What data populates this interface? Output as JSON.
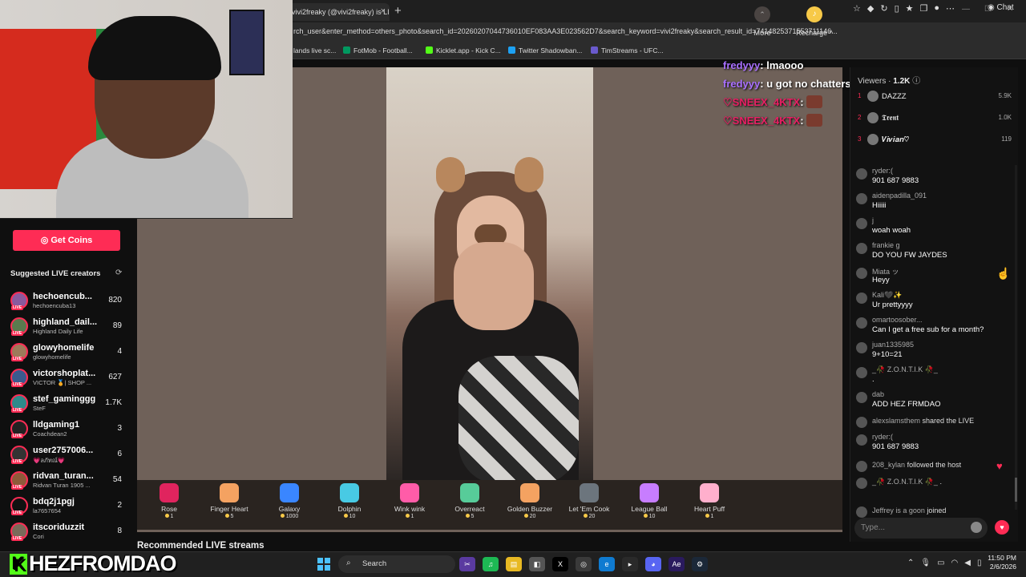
{
  "browser": {
    "tab_title": "vivi2freaky (@vivi2freaky) is LI",
    "new_tab": "+",
    "url": "rch_user&enter_method=others_photo&search_id=20260207044736010EF083AA3E023562D7&search_keyword=vivi2freaky&search_result_id=7414825371553711146...",
    "chat_label": "Chat",
    "bookmarks": [
      {
        "label": "lands live sc...",
        "color": "#333"
      },
      {
        "label": "FotMob - Football...",
        "color": "#00985f"
      },
      {
        "label": "Kicklet.app - Kick C...",
        "color": "#53fc18"
      },
      {
        "label": "Twitter Shadowban...",
        "color": "#1da1f2"
      },
      {
        "label": "TimStreams - UFC...",
        "color": "#6a5acd"
      }
    ]
  },
  "overlay_chat": [
    {
      "name": "fredyyy",
      "message": " lmaooo"
    },
    {
      "name": "fredyyy",
      "message": " u got no chatters"
    },
    {
      "name": "SNEEX_4KTX",
      "message": ""
    },
    {
      "name": "SNEEX_4KTX",
      "message": ""
    }
  ],
  "sidebar": {
    "get_coins": "Get Coins",
    "suggested_title": "Suggested LIVE creators",
    "creators": [
      {
        "name": "hechoencub...",
        "sub": "hechoencuba13",
        "count": "820"
      },
      {
        "name": "highland_dail...",
        "sub": "Highland Daily Life",
        "count": "89"
      },
      {
        "name": "glowyhomelife",
        "sub": "glowyhomelife",
        "count": "4"
      },
      {
        "name": "victorshoplat...",
        "sub": "VICTOR 🏅| SHOP ...",
        "count": "627"
      },
      {
        "name": "stef_gaminggg",
        "sub": "SteF",
        "count": "1.7K"
      },
      {
        "name": "lldgaming1",
        "sub": "Coachdean2",
        "count": "3"
      },
      {
        "name": "user2757006...",
        "sub": "💗ลภัทณ์💗",
        "count": "6"
      },
      {
        "name": "ridvan_turan...",
        "sub": "Ridvan Turan 1905 ...",
        "count": "54"
      },
      {
        "name": "bdq2j1pgj",
        "sub": "la7657654",
        "count": "2"
      },
      {
        "name": "itscoriduzzit",
        "sub": "Cori",
        "count": "8"
      }
    ]
  },
  "gifts": [
    {
      "name": "Rose",
      "price": "1",
      "color": "#e0245e"
    },
    {
      "name": "Finger Heart",
      "price": "5",
      "color": "#f4a261"
    },
    {
      "name": "Galaxy",
      "price": "1000",
      "color": "#3a86ff"
    },
    {
      "name": "Dolphin",
      "price": "10",
      "color": "#48cae4"
    },
    {
      "name": "Wink wink",
      "price": "1",
      "color": "#ff5ca8"
    },
    {
      "name": "Overreact",
      "price": "5",
      "color": "#57cc99"
    },
    {
      "name": "Golden Buzzer",
      "price": "20",
      "color": "#f4a261"
    },
    {
      "name": "Let 'Em Cook",
      "price": "20",
      "color": "#6c757d"
    },
    {
      "name": "League Ball",
      "price": "10",
      "color": "#c77dff"
    },
    {
      "name": "Heart Puff",
      "price": "1",
      "color": "#ffafcc"
    }
  ],
  "more_label": "More",
  "recharge_label": "Recharge ^",
  "recommended_title": "Recommended LIVE streams",
  "chat": {
    "viewers_label": "Viewers",
    "viewers_count": "1.2K",
    "top_viewers": [
      {
        "rank": "1",
        "name": "DAZZZ",
        "score": "5.9K"
      },
      {
        "rank": "2",
        "name": "𝕿𝖗𝖊𝖓𝖙",
        "score": "1.0K"
      },
      {
        "rank": "3",
        "name": "𝑽𝒊𝒗𝒊𝒂𝒏♡",
        "score": "119"
      }
    ],
    "messages": [
      {
        "user": "ryder:(",
        "text": "901 687 9883"
      },
      {
        "user": "aidenpadilla_091",
        "text": "Hiiiii"
      },
      {
        "user": "j",
        "text": "woah woah"
      },
      {
        "user": "frankie g",
        "text": "DO YOU FW JAYDES"
      },
      {
        "user": "Miata ッ",
        "text": "Heyy"
      },
      {
        "user": "Kali🖤✨",
        "text": "Ur prettyyyy"
      },
      {
        "user": "omartoosober...",
        "text": "Can I get a free sub for a month?"
      },
      {
        "user": "juan1335985",
        "text": "9+10=21"
      },
      {
        "user": "_🥀 Z.O.N.T.I.K 🥀_",
        "text": "."
      },
      {
        "user": "dab",
        "text": "ADD HEZ FRMDAO"
      },
      {
        "user": "alexslamsthem",
        "text": "shared the LIVE"
      },
      {
        "user": "ryder:(",
        "text": "901 687 9883"
      },
      {
        "user": "208_kylan",
        "text": "followed the host"
      },
      {
        "user": "_🥀 Z.O.N.T.I.K 🥀_",
        "text": "."
      },
      {
        "user": "Jeffrey is a goon",
        "text": "joined"
      }
    ],
    "input_placeholder": "Type..."
  },
  "taskbar": {
    "brand": "HEZFROMDAO",
    "search_label": "Search",
    "time": "11:50 PM",
    "date": "2/6/2026"
  }
}
